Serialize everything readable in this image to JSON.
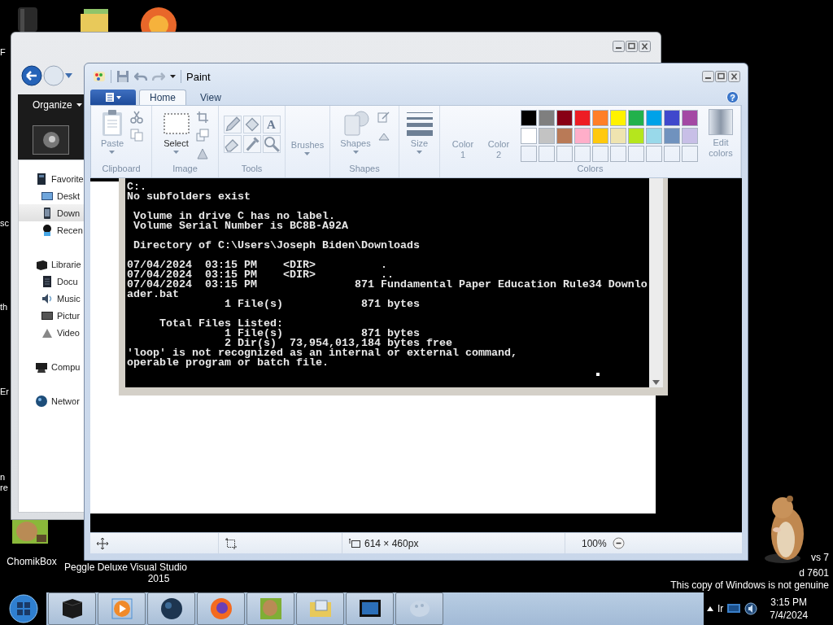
{
  "desktop": {
    "edge_labels": [
      "F",
      "sc",
      "th",
      "Er",
      "n",
      "re"
    ],
    "icons": [
      {
        "label": "ChomikBox"
      },
      {
        "label": "Peggle Deluxe"
      },
      {
        "label": "Visual Studio 2015"
      }
    ],
    "watermark": [
      "vs 7",
      "d 7601",
      "This copy of Windows is not genuine"
    ]
  },
  "explorer": {
    "organize": "Organize",
    "nav": [
      {
        "label": "Favorite",
        "selected": false,
        "children": [
          {
            "label": "Deskt",
            "selected": false
          },
          {
            "label": "Down",
            "selected": true
          },
          {
            "label": "Recen",
            "selected": false
          }
        ]
      },
      {
        "label": "Librarie",
        "selected": false,
        "children": [
          {
            "label": "Docu",
            "selected": false
          },
          {
            "label": "Music",
            "selected": false
          },
          {
            "label": "Pictur",
            "selected": false
          },
          {
            "label": "Video",
            "selected": false
          }
        ]
      },
      {
        "label": "Compu",
        "selected": false
      },
      {
        "label": "Networ",
        "selected": false
      }
    ]
  },
  "paint": {
    "title": "Paint",
    "tabs": [
      {
        "label": "Home",
        "selected": true
      },
      {
        "label": "View",
        "selected": false
      }
    ],
    "help": "?",
    "ribbon": [
      {
        "kind": "clipboard",
        "label": "Clipboard",
        "button": "Paste"
      },
      {
        "kind": "image",
        "label": "Image",
        "button": "Select"
      },
      {
        "kind": "tools",
        "label": "Tools",
        "text_tool": "A"
      },
      {
        "kind": "brushes",
        "button": "Brushes"
      },
      {
        "kind": "shapes",
        "label": "Shapes",
        "button": "Shapes"
      },
      {
        "kind": "size",
        "button": "Size"
      },
      {
        "kind": "colors",
        "label": "Colors",
        "color1": "Color 1",
        "color2": "Color 2",
        "edit": "Edit colors",
        "palette": [
          {
            "color": "#000000"
          },
          {
            "color": "#7f7f7f"
          },
          {
            "color": "#880015"
          },
          {
            "color": "#ed1c24"
          },
          {
            "color": "#ff7f27"
          },
          {
            "color": "#fff200"
          },
          {
            "color": "#22b14c"
          },
          {
            "color": "#00a2e8"
          },
          {
            "color": "#3f48cc"
          },
          {
            "color": "#a349a4"
          },
          {
            "color": "#ffffff"
          },
          {
            "color": "#c3c3c3"
          },
          {
            "color": "#b97a57"
          },
          {
            "color": "#ffaec9"
          },
          {
            "color": "#ffc90e"
          },
          {
            "color": "#efe4b0"
          },
          {
            "color": "#b5e61d"
          },
          {
            "color": "#99d9ea"
          },
          {
            "color": "#7092be"
          },
          {
            "color": "#c8bfe7"
          }
        ]
      }
    ],
    "console": {
      "blocks": [
        [
          "C:.",
          "No subfolders exist"
        ],
        [
          " Volume in drive C has no label.",
          " Volume Serial Number is BC8B-A92A"
        ],
        [
          " Directory of C:\\Users\\Joseph Biden\\Downloads"
        ],
        [
          "07/04/2024  03:15 PM    <DIR>          .",
          "07/04/2024  03:15 PM    <DIR>          ..",
          "07/04/2024  03:15 PM               871 Fundamental Paper Education Rule34 Downlo",
          "ader.bat",
          "               1 File(s)            871 bytes"
        ],
        [
          "     Total Files Listed:",
          "               1 File(s)            871 bytes",
          "               2 Dir(s)  73,954,013,184 bytes free",
          "'loop' is not recognized as an internal or external command,",
          "operable program or batch file."
        ]
      ]
    },
    "status": {
      "size": "614 × 460px",
      "zoom": "100%"
    }
  },
  "taskbar": {
    "tray_text": "Ir",
    "time": "3:15 PM",
    "date": "7/4/2024"
  }
}
